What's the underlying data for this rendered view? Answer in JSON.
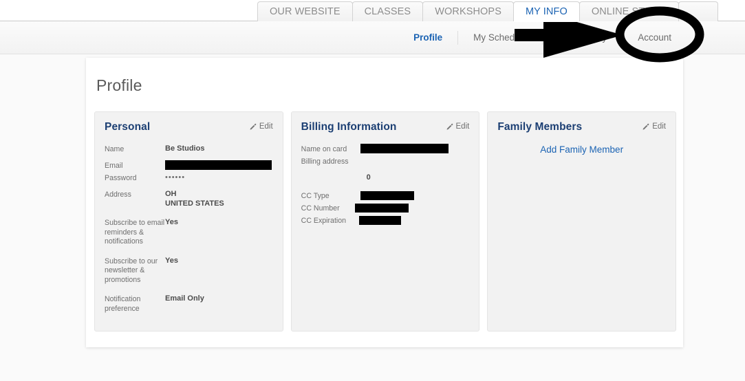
{
  "nav": {
    "tabs": [
      {
        "label": "OUR WEBSITE",
        "active": false
      },
      {
        "label": "CLASSES",
        "active": false
      },
      {
        "label": "WORKSHOPS",
        "active": false
      },
      {
        "label": "MY INFO",
        "active": true
      },
      {
        "label": "ONLINE STORE",
        "active": false
      }
    ],
    "subnav": [
      {
        "label": "Profile",
        "active": true
      },
      {
        "label": "My Schedule",
        "active": false
      },
      {
        "label": "Visit History",
        "active": false
      },
      {
        "label": "Account",
        "active": false
      }
    ]
  },
  "page": {
    "title": "Profile"
  },
  "panels": {
    "personal": {
      "title": "Personal",
      "edit_label": "Edit",
      "edit_icon": "pencil-icon",
      "fields": {
        "name_label": "Name",
        "name_value": "Be Studios",
        "email_label": "Email",
        "email_value": "",
        "password_label": "Password",
        "password_value": "••••••",
        "address_label": "Address",
        "address_line1": "OH",
        "address_line2": "UNITED STATES",
        "subscribe_email_label": "Subscribe to email reminders & notifications",
        "subscribe_email_value": "Yes",
        "subscribe_news_label": "Subscribe to our newsletter & promotions",
        "subscribe_news_value": "Yes",
        "notification_label": "Notification preference",
        "notification_value": "Email Only"
      }
    },
    "billing": {
      "title": "Billing Information",
      "edit_label": "Edit",
      "edit_icon": "pencil-icon",
      "fields": {
        "name_on_card_label": "Name on card",
        "name_on_card_value": "",
        "billing_address_label": "Billing address",
        "billing_address_value": "0",
        "cc_type_label": "CC Type",
        "cc_type_value": "",
        "cc_number_label": "CC Number",
        "cc_number_value": "",
        "cc_expiration_label": "CC Expiration",
        "cc_expiration_value": ""
      }
    },
    "family": {
      "title": "Family Members",
      "edit_label": "Edit",
      "edit_icon": "pencil-icon",
      "add_label": "Add Family Member"
    }
  },
  "annotations": {
    "arrow": "arrow-annotation",
    "ellipse": "ellipse-highlight-annotation",
    "target": "Account"
  },
  "colors": {
    "accent_blue": "#1b63b3",
    "panel_title_blue": "#1c3f73",
    "panel_bg": "#f2f2f2",
    "page_bg": "#fafafa",
    "card_bg": "#ffffff",
    "redaction": "#000000",
    "annotation": "#000000"
  }
}
